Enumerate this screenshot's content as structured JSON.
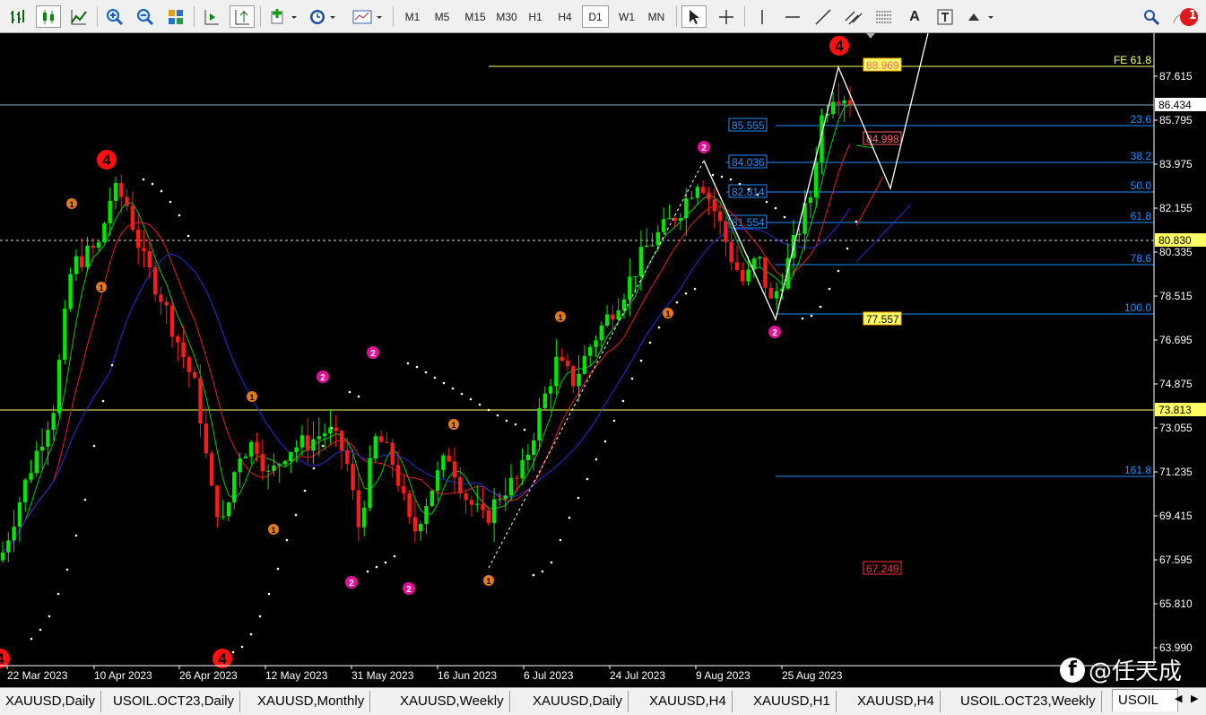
{
  "toolbar": {
    "timeframes": [
      "M1",
      "M5",
      "M15",
      "M30",
      "H1",
      "H4",
      "D1",
      "W1",
      "MN"
    ],
    "active_timeframe": "D1",
    "text_tool_label": "A",
    "notification_count": "1"
  },
  "chart": {
    "price_axis": [
      "87.615",
      "85.795",
      "83.975",
      "82.155",
      "80.335",
      "78.515",
      "76.695",
      "74.875",
      "73.055",
      "71.235",
      "69.415",
      "67.595",
      "65.810",
      "63.990"
    ],
    "date_axis": [
      "22 Mar 2023",
      "10 Apr 2023",
      "26 Apr 2023",
      "12 May 2023",
      "31 May 2023",
      "16 Jun 2023",
      "6 Jul 2023",
      "24 Jul 2023",
      "9 Aug 2023",
      "25 Aug 2023"
    ],
    "current_price": "86.434",
    "price_marker_1": "80.830",
    "price_marker_2": "73.813",
    "fib_levels": [
      {
        "label": "FE 61.8"
      },
      {
        "label": "23.6"
      },
      {
        "label": "38.2"
      },
      {
        "label": "50.0"
      },
      {
        "label": "61.8"
      },
      {
        "label": "78.6"
      },
      {
        "label": "100.0"
      },
      {
        "label": "161.8"
      }
    ],
    "fib_value_boxes": [
      "88.969",
      "85.555",
      "84.998",
      "84.036",
      "82.814",
      "81.554",
      "77.557",
      "67.249"
    ],
    "wave_labels": {
      "four": "4",
      "two": "2",
      "one": "1"
    },
    "colors": {
      "bull": "#00e600",
      "bear": "#ff1a1a",
      "fib": "#1e90ff",
      "ma_fast": "#00c800",
      "ma_mid": "#e02020",
      "ma_slow": "#2030d0",
      "yellow_line": "#ffff66"
    }
  },
  "tabs": [
    "XAUUSD,Daily",
    "USOIL.OCT23,Daily",
    "XAUUSD,Monthly",
    "XAUUSD,Weekly",
    "XAUUSD,Daily",
    "XAUUSD,H4",
    "XAUUSD,H1",
    "XAUUSD,H4",
    "USOIL.OCT23,Weekly",
    "USOIL"
  ],
  "active_tab": "USOIL",
  "watermark": "@任天成"
}
